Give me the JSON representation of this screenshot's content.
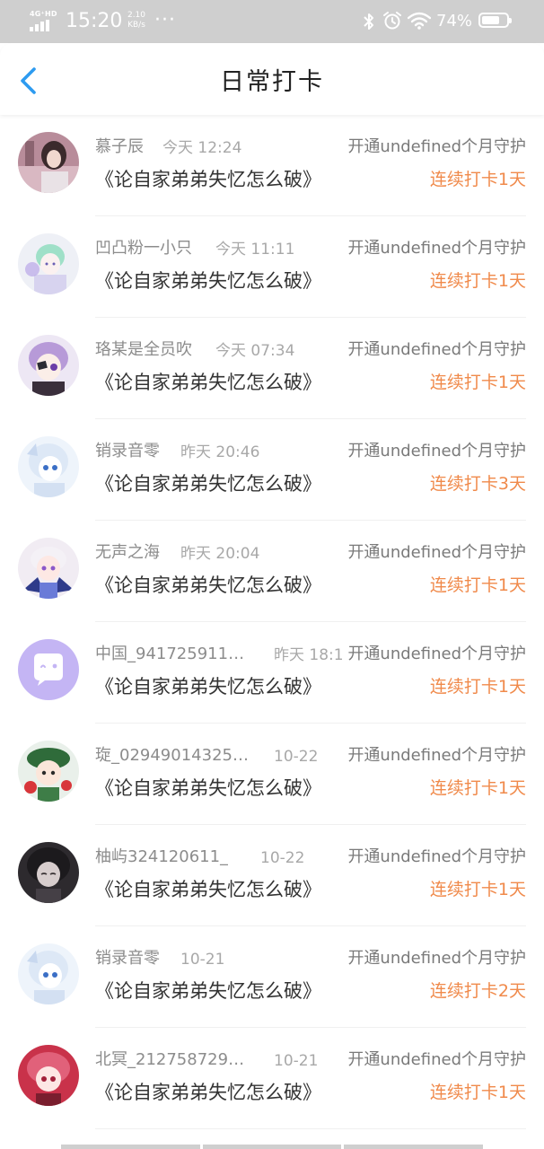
{
  "status_bar": {
    "network": "4G⁺HD",
    "time": "15:20",
    "speed_value": "2.10",
    "speed_unit": "KB/s",
    "more": "···",
    "battery_percent": "74%",
    "battery_level": 0.74,
    "icons": [
      "signal-icon",
      "bluetooth-icon",
      "alarm-icon",
      "wifi-icon",
      "battery-icon"
    ]
  },
  "header": {
    "title": "日常打卡",
    "back_icon": "chevron-left-icon"
  },
  "colors": {
    "accent_blue": "#2d9bf0",
    "streak_orange": "#f08a4b",
    "status_bar_bg": "#cfcfcf"
  },
  "checkins": [
    {
      "name": "慕子辰",
      "time": "今天 12:24",
      "guard": "开通undefined个月守护",
      "book": "《论自家弟弟失忆怎么破》",
      "streak": "连续打卡1天"
    },
    {
      "name": "凹凸粉一小只",
      "time": "今天 11:11",
      "guard": "开通undefined个月守护",
      "book": "《论自家弟弟失忆怎么破》",
      "streak": "连续打卡1天"
    },
    {
      "name": "珞某是全员吹",
      "time": "今天 07:34",
      "guard": "开通undefined个月守护",
      "book": "《论自家弟弟失忆怎么破》",
      "streak": "连续打卡1天"
    },
    {
      "name": "销录音零",
      "time": "昨天 20:46",
      "guard": "开通undefined个月守护",
      "book": "《论自家弟弟失忆怎么破》",
      "streak": "连续打卡3天"
    },
    {
      "name": "无声之海",
      "time": "昨天 20:04",
      "guard": "开通undefined个月守护",
      "book": "《论自家弟弟失忆怎么破》",
      "streak": "连续打卡1天"
    },
    {
      "name": "中国_941725911…",
      "time": "昨天 18:1",
      "guard": "开通undefined个月守护",
      "book": "《论自家弟弟失忆怎么破》",
      "streak": "连续打卡1天"
    },
    {
      "name": "琁_02949014325…",
      "time": "10-22",
      "guard": "开通undefined个月守护",
      "book": "《论自家弟弟失忆怎么破》",
      "streak": "连续打卡1天"
    },
    {
      "name": "柚屿324120611_",
      "time": "10-22",
      "guard": "开通undefined个月守护",
      "book": "《论自家弟弟失忆怎么破》",
      "streak": "连续打卡1天"
    },
    {
      "name": "销录音零",
      "time": "10-21",
      "guard": "开通undefined个月守护",
      "book": "《论自家弟弟失忆怎么破》",
      "streak": "连续打卡2天"
    },
    {
      "name": "北冥_212758729…",
      "time": "10-21",
      "guard": "开通undefined个月守护",
      "book": "《论自家弟弟失忆怎么破》",
      "streak": "连续打卡1天"
    }
  ]
}
